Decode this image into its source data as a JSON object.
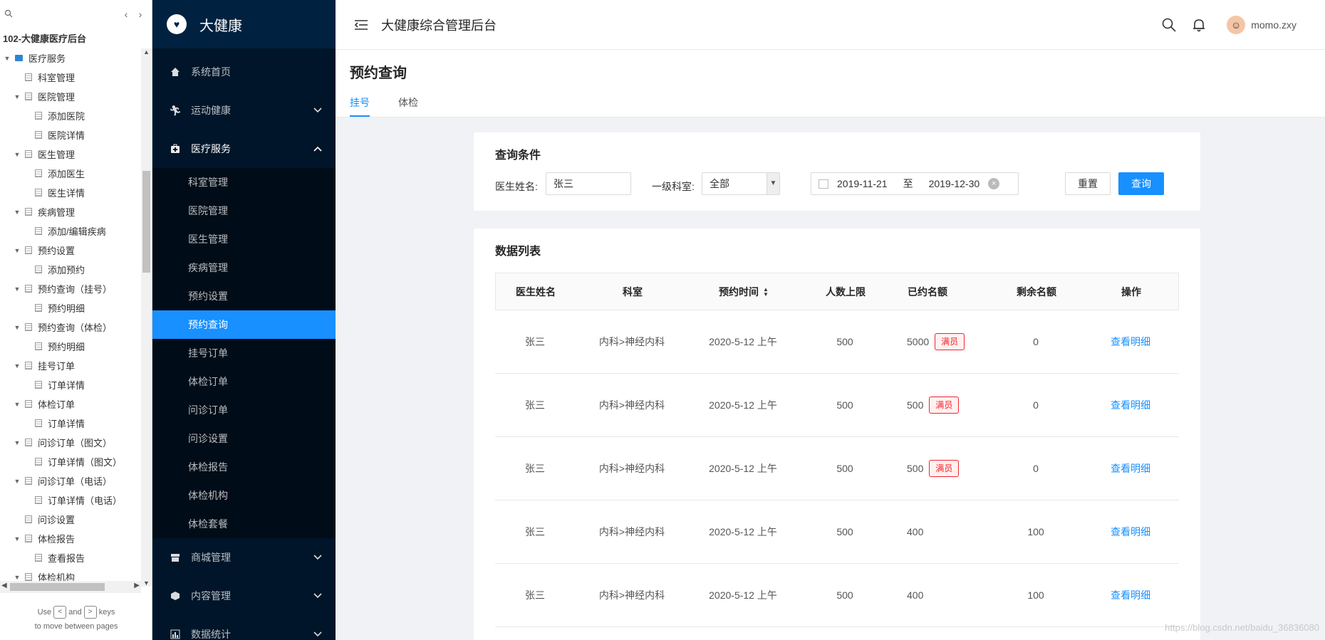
{
  "tree": {
    "title": "102-大健康医疗后台",
    "items": [
      {
        "label": "医疗服务",
        "level": 0,
        "expanded": true,
        "folder": true
      },
      {
        "label": "科室管理",
        "level": 1,
        "leaf": true
      },
      {
        "label": "医院管理",
        "level": 1,
        "expanded": true
      },
      {
        "label": "添加医院",
        "level": 2
      },
      {
        "label": "医院详情",
        "level": 2
      },
      {
        "label": "医生管理",
        "level": 1,
        "expanded": true
      },
      {
        "label": "添加医生",
        "level": 2
      },
      {
        "label": "医生详情",
        "level": 2
      },
      {
        "label": "疾病管理",
        "level": 1,
        "expanded": true
      },
      {
        "label": "添加/编辑疾病",
        "level": 2
      },
      {
        "label": "预约设置",
        "level": 1,
        "expanded": true
      },
      {
        "label": "添加预约",
        "level": 2
      },
      {
        "label": "预约查询（挂号）",
        "level": 1,
        "expanded": true
      },
      {
        "label": "预约明细",
        "level": 2
      },
      {
        "label": "预约查询（体检）",
        "level": 1,
        "expanded": true
      },
      {
        "label": "预约明细",
        "level": 2
      },
      {
        "label": "挂号订单",
        "level": 1,
        "expanded": true
      },
      {
        "label": "订单详情",
        "level": 2
      },
      {
        "label": "体检订单",
        "level": 1,
        "expanded": true
      },
      {
        "label": "订单详情",
        "level": 2
      },
      {
        "label": "问诊订单（图文）",
        "level": 1,
        "expanded": true
      },
      {
        "label": "订单详情（图文）",
        "level": 2
      },
      {
        "label": "问诊订单（电话）",
        "level": 1,
        "expanded": true
      },
      {
        "label": "订单详情（电话）",
        "level": 2
      },
      {
        "label": "问诊设置",
        "level": 1,
        "leaf": true
      },
      {
        "label": "体检报告",
        "level": 1,
        "expanded": true
      },
      {
        "label": "查看报告",
        "level": 2
      },
      {
        "label": "体检机构",
        "level": 1,
        "expanded": true
      }
    ],
    "hint_use": "Use",
    "hint_and": "and",
    "hint_keys": "keys",
    "hint_line2": "to move between pages"
  },
  "brand": {
    "name": "大健康",
    "logo_icon": "heart-pulse-icon"
  },
  "menu": {
    "home": "系统首页",
    "sport": "运动健康",
    "medical": "医疗服务",
    "sub": [
      "科室管理",
      "医院管理",
      "医生管理",
      "疾病管理",
      "预约设置",
      "预约查询",
      "挂号订单",
      "体检订单",
      "问诊订单",
      "问诊设置",
      "体检报告",
      "体检机构",
      "体检套餐"
    ],
    "active_index": 5,
    "mall": "商城管理",
    "content": "内容管理",
    "stats": "数据统计"
  },
  "header": {
    "title": "大健康综合管理后台",
    "username": "momo.zxy"
  },
  "page": {
    "title": "预约查询",
    "tabs": [
      "挂号",
      "体检"
    ],
    "active_tab": 0
  },
  "query": {
    "title": "查询条件",
    "doctor_label": "医生姓名:",
    "doctor_value": "张三",
    "dept_label": "一级科室:",
    "dept_value": "全部",
    "date_start": "2019-11-21",
    "date_sep": "至",
    "date_end": "2019-12-30",
    "reset": "重置",
    "search": "查询"
  },
  "list": {
    "title": "数据列表",
    "columns": [
      "医生姓名",
      "科室",
      "预约时间",
      "人数上限",
      "已约名额",
      "剩余名额",
      "操作"
    ],
    "rows": [
      {
        "doctor": "张三",
        "dept": "内科>神经内科",
        "time": "2020-5-12 上午",
        "limit": "500",
        "booked": "5000",
        "full": "满员",
        "remain": "0",
        "action": "查看明细"
      },
      {
        "doctor": "张三",
        "dept": "内科>神经内科",
        "time": "2020-5-12 上午",
        "limit": "500",
        "booked": "500",
        "full": "满员",
        "remain": "0",
        "action": "查看明细"
      },
      {
        "doctor": "张三",
        "dept": "内科>神经内科",
        "time": "2020-5-12 上午",
        "limit": "500",
        "booked": "500",
        "full": "满员",
        "remain": "0",
        "action": "查看明细"
      },
      {
        "doctor": "张三",
        "dept": "内科>神经内科",
        "time": "2020-5-12 上午",
        "limit": "500",
        "booked": "400",
        "full": "",
        "remain": "100",
        "action": "查看明细"
      },
      {
        "doctor": "张三",
        "dept": "内科>神经内科",
        "time": "2020-5-12 上午",
        "limit": "500",
        "booked": "400",
        "full": "",
        "remain": "100",
        "action": "查看明细"
      }
    ]
  },
  "watermark": "https://blog.csdn.net/baidu_36836080",
  "colors": {
    "primary": "#1890ff",
    "sidebar": "#001529",
    "danger": "#f5222d"
  }
}
